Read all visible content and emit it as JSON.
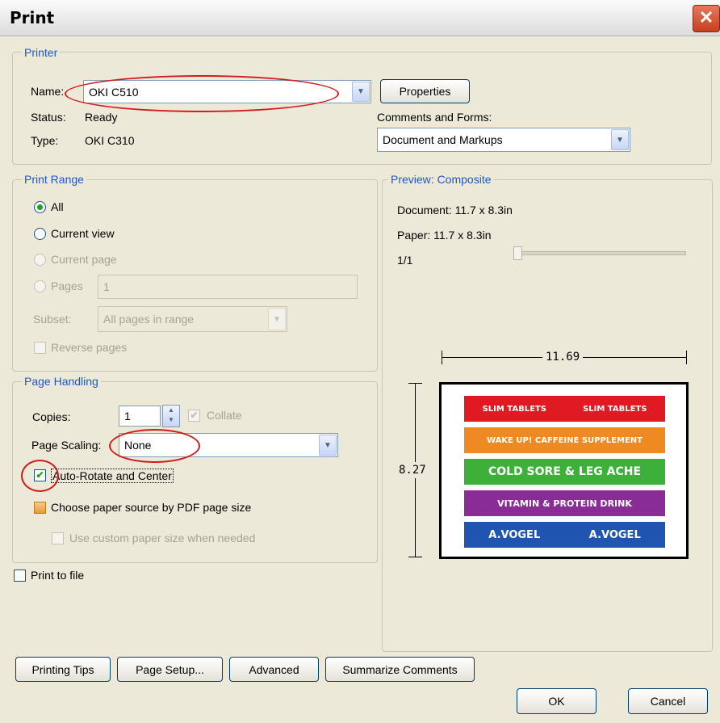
{
  "window": {
    "title": "Print",
    "close_glyph": "✕"
  },
  "printer": {
    "group_label": "Printer",
    "name_label": "Name:",
    "name_value": "OKI C510",
    "properties_label": "Properties",
    "status_label": "Status:",
    "status_value": "Ready",
    "type_label": "Type:",
    "type_value": "OKI C310",
    "comments_label": "Comments and Forms:",
    "comments_value": "Document and Markups"
  },
  "print_range": {
    "group_label": "Print Range",
    "all_label": "All",
    "current_view_label": "Current view",
    "current_page_label": "Current page",
    "pages_label": "Pages",
    "pages_value": "1",
    "subset_label": "Subset:",
    "subset_value": "All pages in range",
    "reverse_label": "Reverse pages"
  },
  "page_handling": {
    "group_label": "Page Handling",
    "copies_label": "Copies:",
    "copies_value": "1",
    "collate_label": "Collate",
    "scaling_label": "Page Scaling:",
    "scaling_value": "None",
    "auto_rotate_label": "Auto-Rotate and Center",
    "paper_source_label": "Choose paper source by PDF page size",
    "custom_paper_label": "Use custom paper size when needed"
  },
  "print_to_file_label": "Print to file",
  "preview": {
    "group_label": "Preview: Composite",
    "document_line": "Document: 11.7 x 8.3in",
    "paper_line": "Paper: 11.7 x 8.3in",
    "page_count": "1/1",
    "width_label": "11.69",
    "height_label": "8.27",
    "strips": [
      {
        "left": "SLIM TABLETS",
        "right": "SLIM TABLETS",
        "color": "#e01a22"
      },
      {
        "left": "WAKE UP! CAFFEINE SUPPLEMENT",
        "right": "",
        "color": "#ef8a22"
      },
      {
        "left": "COLD SORE & LEG ACHE",
        "right": "",
        "color": "#3db03a"
      },
      {
        "left": "VITAMIN & PROTEIN DRINK",
        "right": "",
        "color": "#8a2c96"
      },
      {
        "left": "A.VOGEL",
        "right": "A.VOGEL",
        "color": "#1f55b0"
      }
    ]
  },
  "buttons": {
    "printing_tips": "Printing Tips",
    "page_setup": "Page Setup...",
    "advanced": "Advanced",
    "summarize": "Summarize Comments",
    "ok": "OK",
    "cancel": "Cancel"
  },
  "colors": {
    "annotation_red": "#d21c1c",
    "group_label_blue": "#1f56c8"
  }
}
